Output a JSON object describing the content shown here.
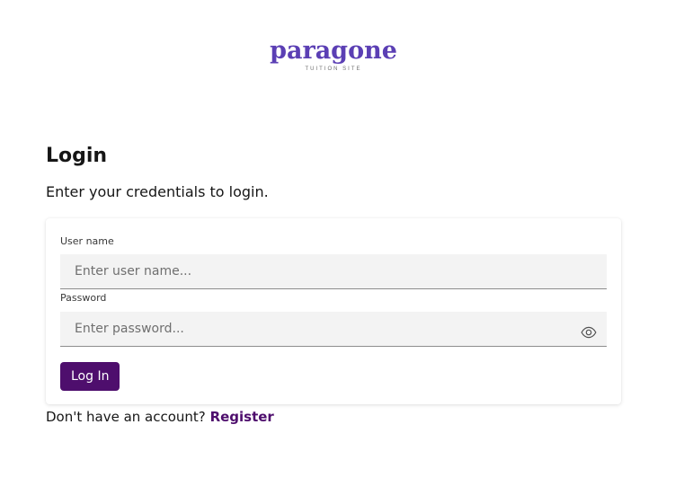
{
  "brand": {
    "logo_text": "paragone",
    "logo_tagline": "TUITION SITE",
    "logo_color": "#5b3fb4"
  },
  "login": {
    "title": "Login",
    "subtitle": "Enter your credentials to login.",
    "username": {
      "label": "User name",
      "placeholder": "Enter user name...",
      "value": ""
    },
    "password": {
      "label": "Password",
      "placeholder": "Enter password...",
      "value": "",
      "toggle_icon": "eye-icon"
    },
    "submit_label": "Log In",
    "accent_color": "#4e0e6d"
  },
  "footer": {
    "prompt_text": "Don't have an account?",
    "register_label": "Register"
  }
}
